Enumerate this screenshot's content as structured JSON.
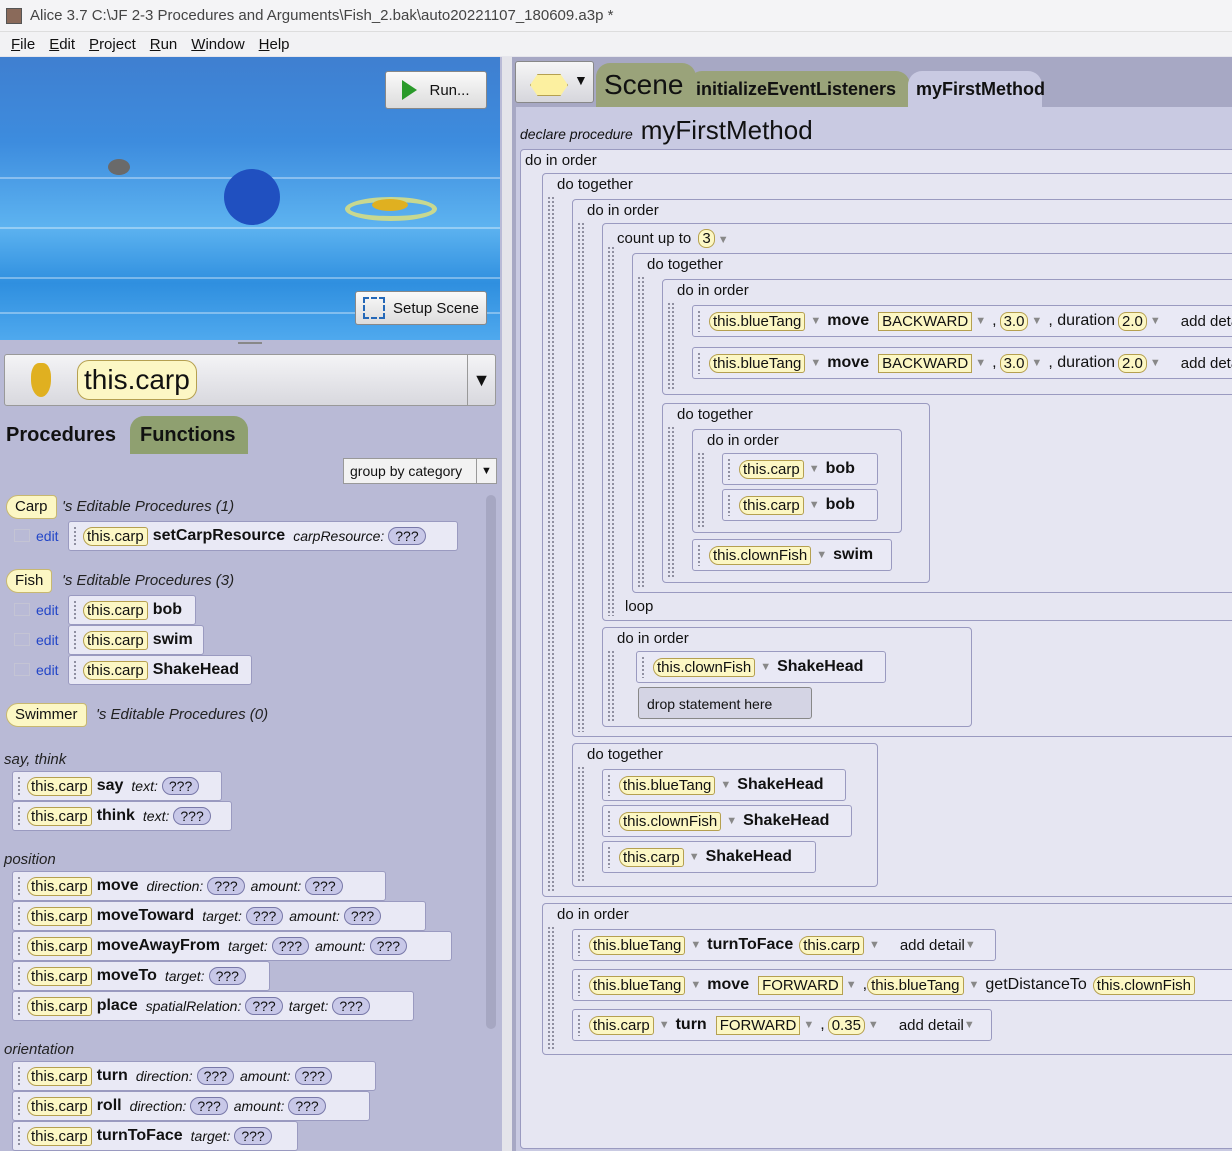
{
  "window": {
    "title": "Alice 3.7 C:\\JF 2-3 Procedures and Arguments\\Fish_2.bak\\auto20221107_180609.a3p *"
  },
  "menu": [
    "File",
    "Edit",
    "Project",
    "Run",
    "Window",
    "Help"
  ],
  "scene_view": {
    "run_label": "Run...",
    "setup_label": "Setup Scene"
  },
  "selector": {
    "name": "this.carp"
  },
  "left_tabs": {
    "procedures": "Procedures",
    "functions": "Functions"
  },
  "groupby": "group by category",
  "categories": [
    {
      "cls": "Carp",
      "text": "'s Editable Procedures (1)"
    },
    {
      "cls": "Fish",
      "text": "'s Editable Procedures (3)"
    },
    {
      "cls": "Swimmer",
      "text": "'s Editable Procedures (0)"
    }
  ],
  "edit_label": "edit",
  "obj": "this.carp",
  "carp_procs": {
    "name": "setCarpResource",
    "param": "carpResource:",
    "q": "???"
  },
  "fish_procs": [
    "bob",
    "swim",
    "ShakeHead"
  ],
  "sections": {
    "say": "say, think",
    "position": "position",
    "orientation": "orientation"
  },
  "say_blocks": [
    {
      "m": "say",
      "p1": "text:"
    },
    {
      "m": "think",
      "p1": "text:"
    }
  ],
  "position_blocks": [
    {
      "m": "move",
      "p1": "direction:",
      "p2": "amount:"
    },
    {
      "m": "moveToward",
      "p1": "target:",
      "p2": "amount:"
    },
    {
      "m": "moveAwayFrom",
      "p1": "target:",
      "p2": "amount:"
    },
    {
      "m": "moveTo",
      "p1": "target:"
    },
    {
      "m": "place",
      "p1": "spatialRelation:",
      "p2": "target:"
    }
  ],
  "orientation_blocks": [
    {
      "m": "turn",
      "p1": "direction:",
      "p2": "amount:"
    },
    {
      "m": "roll",
      "p1": "direction:",
      "p2": "amount:"
    },
    {
      "m": "turnToFace",
      "p1": "target:"
    }
  ],
  "q": "???",
  "right_tabs": {
    "scene": "Scene",
    "init": "initializeEventListeners",
    "mfm": "myFirstMethod"
  },
  "declare": {
    "prefix": "declare procedure",
    "name": "myFirstMethod"
  },
  "code": {
    "do_in_order": "do in order",
    "do_together": "do together",
    "count_up_to": "count up to",
    "count_val": "3",
    "loop": "loop",
    "drop": "drop statement here",
    "move": "move",
    "backward": "BACKWARD",
    "forward": "FORWARD",
    "amt": "3.0",
    "duration": ", duration",
    "dur": "2.0",
    "add_detail": "add detail",
    "bob": "bob",
    "swim": "swim",
    "shakehead": "ShakeHead",
    "turntoface": "turnToFace",
    "turn": "turn",
    "turnamt": "0.35",
    "getdist": "getDistanceTo",
    "blueTang": "this.blueTang",
    "clownFish": "this.clownFish",
    "carp": "this.carp"
  }
}
